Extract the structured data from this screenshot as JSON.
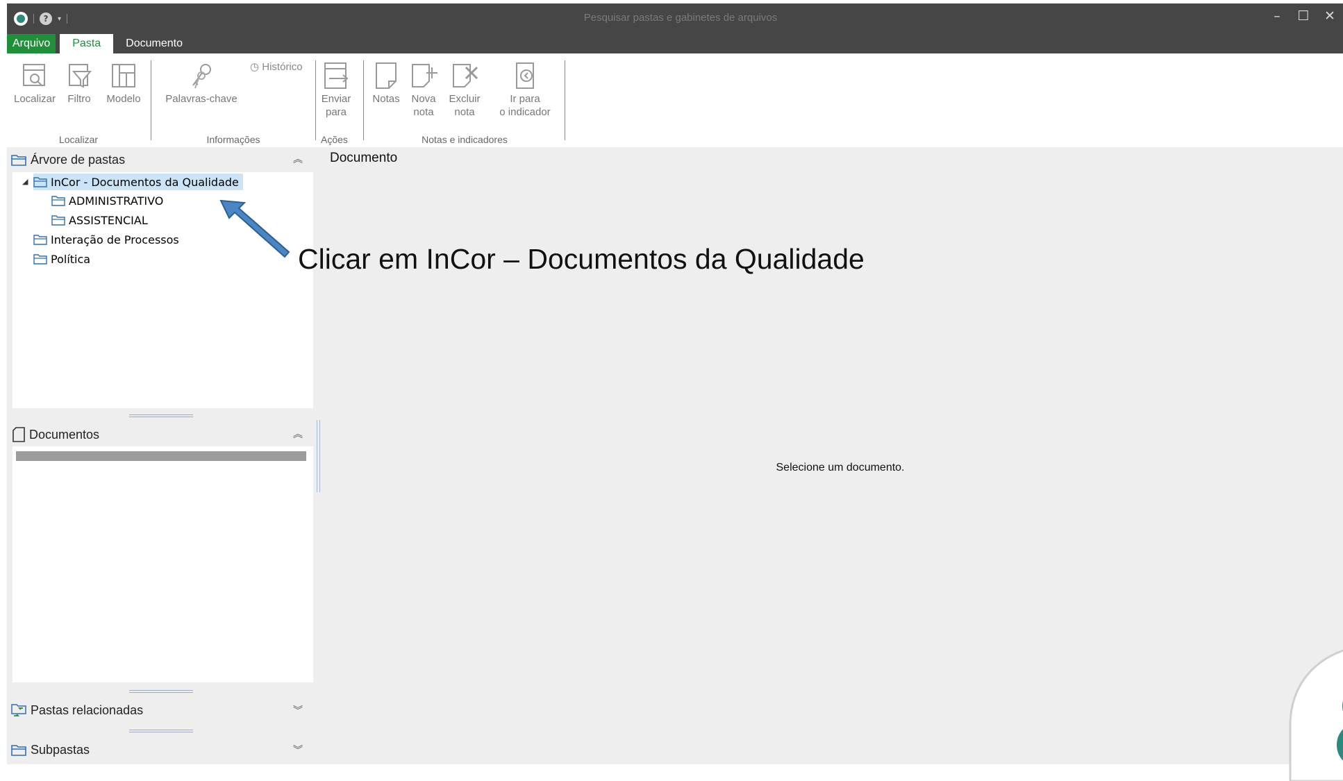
{
  "titlebar": {
    "search_placeholder": "Pesquisar pastas e gabinetes de arquivos",
    "window_controls": {
      "minimize": "–",
      "maximize": "☐",
      "close": "✕"
    }
  },
  "tabs": {
    "file": "Arquivo",
    "folder": "Pasta",
    "document": "Documento"
  },
  "ribbon": {
    "groups": {
      "localizar": "Localizar",
      "informacoes": "Informações",
      "acoes": "Ações",
      "notas": "Notas e indicadores"
    },
    "buttons": {
      "localizar": "Localizar",
      "filtro": "Filtro",
      "modelo": "Modelo",
      "palavras": "Palavras-chave",
      "historico": "Histórico",
      "enviar_1": "Enviar",
      "enviar_2": "para",
      "notas": "Notas",
      "nova_1": "Nova",
      "nova_2": "nota",
      "excluir_1": "Excluir",
      "excluir_2": "nota",
      "ir_1": "Ir para",
      "ir_2": "o indicador"
    }
  },
  "folder_tree": {
    "title": "Árvore de pastas",
    "root": "InCor - Documentos da Qualidade",
    "children": [
      "ADMINISTRATIVO",
      "ASSISTENCIAL"
    ],
    "others": [
      "Interação de Processos",
      "Política"
    ]
  },
  "documents_panel": {
    "title": "Documentos"
  },
  "related_panel": {
    "title": "Pastas relacionadas"
  },
  "subfolders_panel": {
    "title": "Subpastas"
  },
  "document_view": {
    "title": "Documento",
    "empty_message": "Selecione um documento."
  },
  "annotation": {
    "text": "Clicar em InCor – Documentos da Qualidade"
  },
  "colors": {
    "titlebar": "#464646",
    "file_tab": "#1f8f3a",
    "selection": "#cce4f7",
    "arrow": "#4a86c4",
    "badge": "#2b8a7e"
  }
}
